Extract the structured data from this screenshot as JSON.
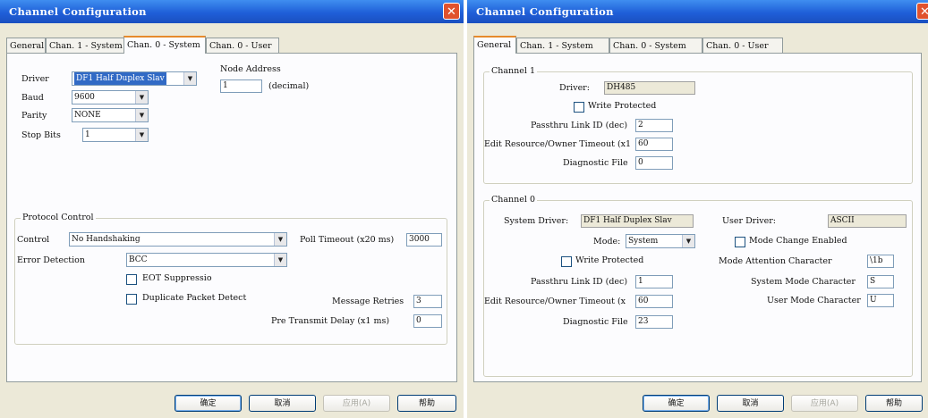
{
  "left": {
    "title": "Channel Configuration",
    "tabs": [
      "General",
      "Chan. 1 - System",
      "Chan. 0 - System",
      "Chan. 0 - User"
    ],
    "driver_label": "Driver",
    "driver_value": "DF1 Half Duplex Slav",
    "node_address_label": "Node Address",
    "node_address_value": "1",
    "decimal_label": "(decimal)",
    "baud_label": "Baud",
    "baud_value": "9600",
    "parity_label": "Parity",
    "parity_value": "NONE",
    "stop_bits_label": "Stop Bits",
    "stop_bits_value": "1",
    "protocol_control_title": "Protocol Control",
    "control_label": "Control",
    "control_value": "No Handshaking",
    "poll_timeout_label": "Poll Timeout (x20 ms)",
    "poll_timeout_value": "3000",
    "error_detection_label": "Error Detection",
    "error_detection_value": "BCC",
    "eot_suppression_label": "EOT Suppressio",
    "duplicate_packet_label": "Duplicate Packet Detect",
    "message_retries_label": "Message Retries",
    "message_retries_value": "3",
    "pre_transmit_label": "Pre Transmit Delay (x1 ms)",
    "pre_transmit_value": "0",
    "buttons": [
      "确定",
      "取消",
      "应用(A)",
      "帮助"
    ]
  },
  "right": {
    "title": "Channel Configuration",
    "tabs": [
      "General",
      "Chan. 1 - System",
      "Chan. 0 - System",
      "Chan. 0 - User"
    ],
    "channel1": {
      "title": "Channel 1",
      "driver_label": "Driver:",
      "driver_value": "DH485",
      "write_protected_label": "Write Protected",
      "passthru_label": "Passthru Link ID (dec)",
      "passthru_value": "2",
      "edit_resource_label": "Edit Resource/Owner Timeout (x1",
      "edit_resource_value": "60",
      "diag_label": "Diagnostic File",
      "diag_value": "0"
    },
    "channel0": {
      "title": "Channel 0",
      "system_driver_label": "System Driver:",
      "system_driver_value": "DF1 Half Duplex Slav",
      "user_driver_label": "User Driver:",
      "user_driver_value": "ASCII",
      "mode_label": "Mode:",
      "mode_value": "System",
      "mode_change_label": "Mode Change Enabled",
      "write_protected_label": "Write Protected",
      "mode_attention_label": "Mode Attention Character",
      "mode_attention_value": "\\1b",
      "passthru_label": "Passthru Link ID (dec)",
      "passthru_value": "1",
      "system_mode_char_label": "System Mode Character",
      "system_mode_char_value": "S",
      "edit_resource_label": "Edit Resource/Owner Timeout (x",
      "edit_resource_value": "60",
      "user_mode_char_label": "User Mode Character",
      "user_mode_char_value": "U",
      "diag_label": "Diagnostic File",
      "diag_value": "23"
    },
    "buttons": [
      "确定",
      "取消",
      "应用(A)",
      "帮助"
    ]
  },
  "colors": {
    "titlebar": "#1f5fd8",
    "dialog_bg": "#ece9d8",
    "panel_bg": "#fcfcfe",
    "close_button": "#e0522e",
    "selection": "#316ac5",
    "active_tab_accent": "#e68b2c"
  },
  "icons": [
    "close-icon",
    "dropdown-arrow-icon",
    "checkbox-icon"
  ]
}
